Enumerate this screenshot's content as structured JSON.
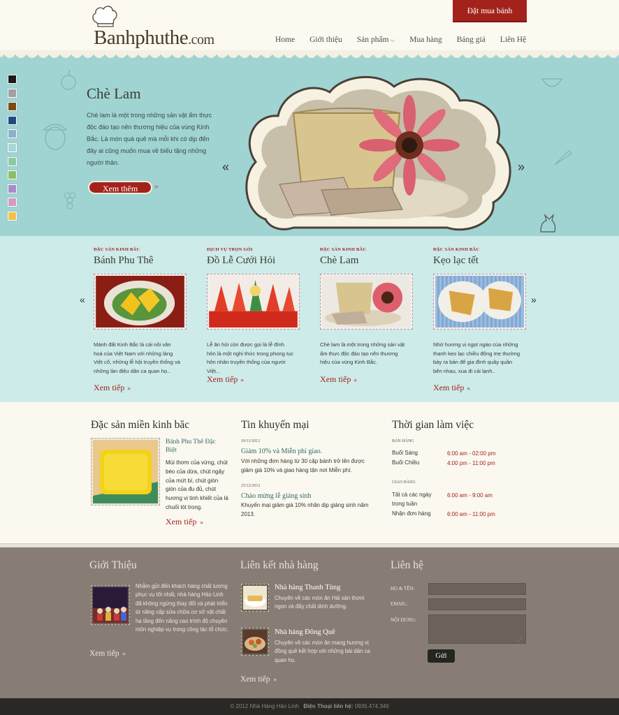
{
  "header": {
    "logo_main": "Banhphuthe",
    "logo_domain": ".com",
    "order_button": "Đặt mua bánh",
    "nav": [
      {
        "label": "Home"
      },
      {
        "label": "Giới thiệu"
      },
      {
        "label": "Sản phẩm"
      },
      {
        "label": "Mua hàng"
      },
      {
        "label": "Bảng giá"
      },
      {
        "label": "Liên Hệ"
      }
    ]
  },
  "swatches": [
    "#1b1b1b",
    "#a0a0a0",
    "#7a4b12",
    "#204b80",
    "#8ab3c9",
    "#a9d6da",
    "#8fc9a4",
    "#89c065",
    "#a78cca",
    "#d59bc1",
    "#f1c24a"
  ],
  "hero": {
    "title": "Chè Lam",
    "description": "Chè lam là một trong những sản vật ẩm thực độc đáo tạo nên thương hiệu của vùng Kinh Bắc. Là món quà quê mà mỗi khi có dịp đến đây ai cũng muốn mua về biếu tặng những người thân.",
    "button": "Xem thêm"
  },
  "products": [
    {
      "category": "ĐẶC SẢN KINH BẮC",
      "name": "Bánh Phu Thê",
      "description": "Mảnh đất Kinh Bắc là cái nôi văn hoá của Việt Nam với những làng Việt cổ, những lễ hội truyền thống và những làn điệu dân ca quan họ..",
      "more": "Xem tiếp"
    },
    {
      "category": "DỊCH VỤ TRỌN GÓI",
      "name": "Đồ Lễ Cưới Hỏi",
      "description": "Lễ ăn hỏi còn được gọi là lễ đính hôn là một nghi thức trong phong tục hôn nhân truyền thống của người Việt...",
      "more": "Xem tiếp"
    },
    {
      "category": "ĐẶC SẢN KINH BẮC",
      "name": "Chè Lam",
      "description": "Chè lam là một trong những sản vật ẩm thực độc đáo tạo nên thương hiệu của vùng Kinh Bắc.",
      "more": "Xem tiếp"
    },
    {
      "category": "ĐẶC SẢN KINH BẮC",
      "name": "Kẹo lạc tết",
      "description": "Nhớ hương vị ngọt ngào của những thanh kẹo lạc chiều đông mẹ thường bày ra bàn để gia đình quây quần bên nhau, xua đi cái lạnh..",
      "more": "Xem tiếp"
    }
  ],
  "specialty": {
    "title": "Đặc sản miền kinh băc",
    "item_name": "Bánh Phu Thê Đặc Biệt",
    "item_desc": "Mùi thơm của vừng, chút béo của dừa, chút ngậy của mứt bí, chút giòn giòn của đu đủ, chút hương vị tinh khiết của lá chuối lót trong.",
    "more": "Xem tiếp"
  },
  "promotions": {
    "title": "Tin khuyến mại",
    "items": [
      {
        "date": "10/11/2012",
        "title": "Giảm 10% và Miễn phí giao.",
        "desc": "Với những đơn hàng từ 30 cặp bánh trở lên được giảm giá 10% và giao hàng tận nơi Miễn phí."
      },
      {
        "date": "25/12/2012",
        "title": "Chào mừng lễ giáng sinh",
        "desc": "Khuyến mại giảm giá 10% nhân dịp giáng sinh năm 2013."
      }
    ]
  },
  "hours": {
    "title": "Thời gian làm việc",
    "sales_heading": "BÁN HÀNG",
    "sales": [
      {
        "label": "Buổi Sáng",
        "value": "6:00 am - 02:00 pm"
      },
      {
        "label": "Buổi Chiều",
        "value": "4:00 pm - 11:00 pm"
      }
    ],
    "delivery_heading": "GIAO HÀNG",
    "delivery": [
      {
        "label": "Tất cả các ngày trong tuần",
        "value": "6:00 am - 9:00 am"
      },
      {
        "label": "Nhận đơn hàng",
        "value": "6:00 am - 11:00 pm"
      }
    ]
  },
  "footer": {
    "about_title": "Giới Thiệu",
    "about_text": "Nhằm gửi đến khách hàng chất lượng phục vụ tốt nhất, nhà hàng Hảo Linh đã không ngừng thay đổi và phát triển từ nâng cấp sửa chữa cơ sở vật chất hạ tầng đến nâng cao trình độ chuyên môn nghiệp vụ trong công tác tổ chức.",
    "about_more": "Xem tiếp",
    "links_title": "Liên kết nhà hàng",
    "restaurants": [
      {
        "name": "Nhà hàng Thanh Tùng",
        "desc": "Chuyên về các món ăn Hải sản thơm ngon và đầy chất dinh dưỡng."
      },
      {
        "name": "Nhà hàng Đông Quê",
        "desc": "Chuyên về các món ăn mang hương vị đồng quê kết hợp với những bài dân ca quan họ."
      }
    ],
    "links_more": "Xem tiếp",
    "contact_title": "Liên hệ",
    "name_label": "HỌ & TÊN:",
    "email_label": "EMAIL:",
    "content_label": "NỘI DUNG:",
    "send_button": "Gửi"
  },
  "copyright": {
    "text": "© 2012 Nhà Hàng Hảo Linh",
    "phone_label": "Điện Thoại liên hệ:",
    "phone": "0936.474.346"
  }
}
